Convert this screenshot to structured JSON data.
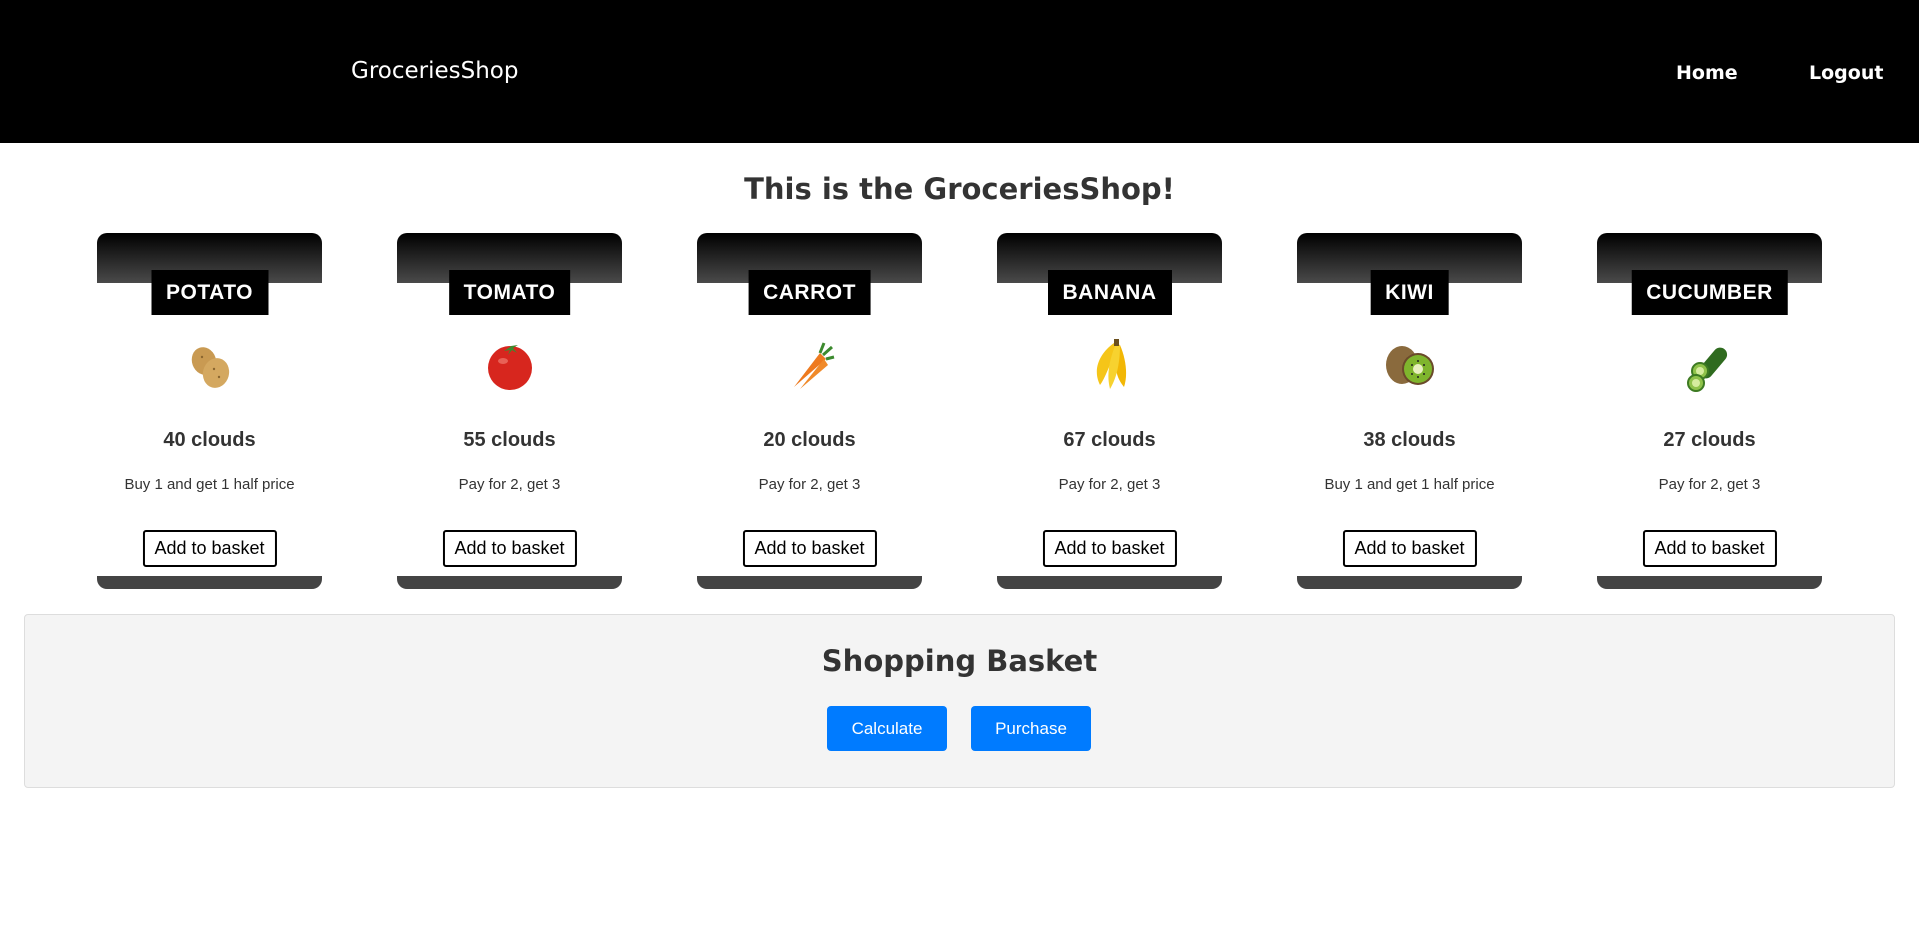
{
  "header": {
    "brand": "GroceriesShop",
    "nav": {
      "home": "Home",
      "logout": "Logout"
    }
  },
  "main": {
    "title": "This is the GroceriesShop!"
  },
  "products": [
    {
      "name": "POTATO",
      "icon": "potato-icon",
      "price": "40 clouds",
      "offer": "Buy 1 and get 1 half price",
      "button": "Add to basket"
    },
    {
      "name": "TOMATO",
      "icon": "tomato-icon",
      "price": "55 clouds",
      "offer": "Pay for 2, get 3",
      "button": "Add to basket"
    },
    {
      "name": "CARROT",
      "icon": "carrot-icon",
      "price": "20 clouds",
      "offer": "Pay for 2, get 3",
      "button": "Add to basket"
    },
    {
      "name": "BANANA",
      "icon": "banana-icon",
      "price": "67 clouds",
      "offer": "Pay for 2, get 3",
      "button": "Add to basket"
    },
    {
      "name": "KIWI",
      "icon": "kiwi-icon",
      "price": "38 clouds",
      "offer": "Buy 1 and get 1 half price",
      "button": "Add to basket"
    },
    {
      "name": "CUCUMBER",
      "icon": "cucumber-icon",
      "price": "27 clouds",
      "offer": "Pay for 2, get 3",
      "button": "Add to basket"
    }
  ],
  "basket": {
    "title": "Shopping Basket",
    "calculate": "Calculate",
    "purchase": "Purchase"
  },
  "colors": {
    "header_bg": "#000000",
    "primary_button": "#007bff",
    "basket_bg": "#f4f4f4"
  }
}
